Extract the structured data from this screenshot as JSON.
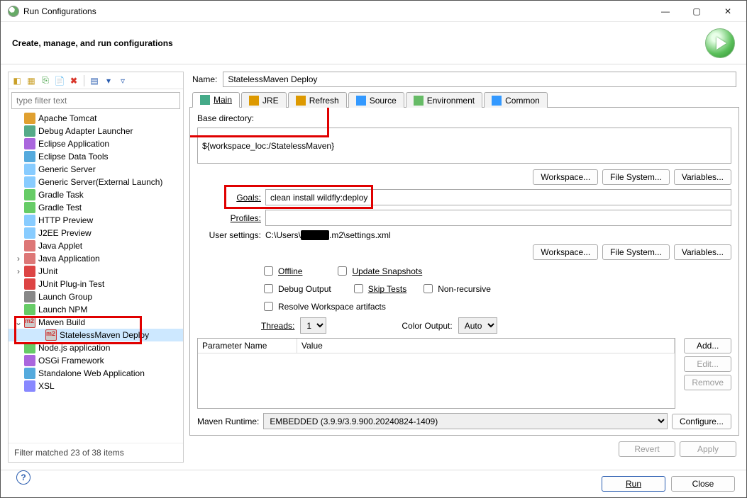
{
  "window_title": "Run Configurations",
  "header_text": "Create, manage, and run configurations",
  "filter_placeholder": "type filter text",
  "tree": [
    {
      "label": "Apache Tomcat"
    },
    {
      "label": "Debug Adapter Launcher"
    },
    {
      "label": "Eclipse Application"
    },
    {
      "label": "Eclipse Data Tools"
    },
    {
      "label": "Generic Server"
    },
    {
      "label": "Generic Server(External Launch)"
    },
    {
      "label": "Gradle Task"
    },
    {
      "label": "Gradle Test"
    },
    {
      "label": "HTTP Preview"
    },
    {
      "label": "J2EE Preview"
    },
    {
      "label": "Java Applet"
    },
    {
      "label": "Java Application",
      "expandable": true
    },
    {
      "label": "JUnit",
      "expandable": true
    },
    {
      "label": "JUnit Plug-in Test"
    },
    {
      "label": "Launch Group"
    },
    {
      "label": "Launch NPM"
    },
    {
      "label": "Maven Build",
      "expanded": true,
      "children": [
        {
          "label": "StatelessMaven Deploy",
          "selected": true
        }
      ]
    },
    {
      "label": "Node.js application"
    },
    {
      "label": "OSGi Framework"
    },
    {
      "label": "Standalone Web Application"
    },
    {
      "label": "XSL"
    }
  ],
  "filter_matched": "Filter matched 23 of 38 items",
  "name_label": "Name:",
  "name_value": "StatelessMaven Deploy",
  "tabs": [
    "Main",
    "JRE",
    "Refresh",
    "Source",
    "Environment",
    "Common"
  ],
  "base_dir_label": "Base directory:",
  "base_dir_value": "${workspace_loc:/StatelessMaven}",
  "buttons": {
    "workspace": "Workspace...",
    "filesystem": "File System...",
    "variables": "Variables...",
    "add": "Add...",
    "edit": "Edit...",
    "remove": "Remove",
    "configure": "Configure...",
    "revert": "Revert",
    "apply": "Apply",
    "run": "Run",
    "close": "Close"
  },
  "goals_label": "Goals:",
  "goals_value": "clean install wildfly:deploy",
  "profiles_label": "Profiles:",
  "profiles_value": "",
  "usersettings_label": "User settings:",
  "usersettings_prefix": "C:\\Users\\",
  "usersettings_suffix": ".m2\\settings.xml",
  "checks": {
    "offline": "Offline",
    "update": "Update Snapshots",
    "debug": "Debug Output",
    "skip": "Skip Tests",
    "nonrec": "Non-recursive",
    "resolve": "Resolve Workspace artifacts"
  },
  "threads_label": "Threads:",
  "threads_value": "1",
  "color_label": "Color Output:",
  "color_value": "Auto",
  "param_headers": {
    "name": "Parameter Name",
    "value": "Value"
  },
  "runtime_label": "Maven Runtime:",
  "runtime_value": "EMBEDDED (3.9.9/3.9.900.20240824-1409)"
}
